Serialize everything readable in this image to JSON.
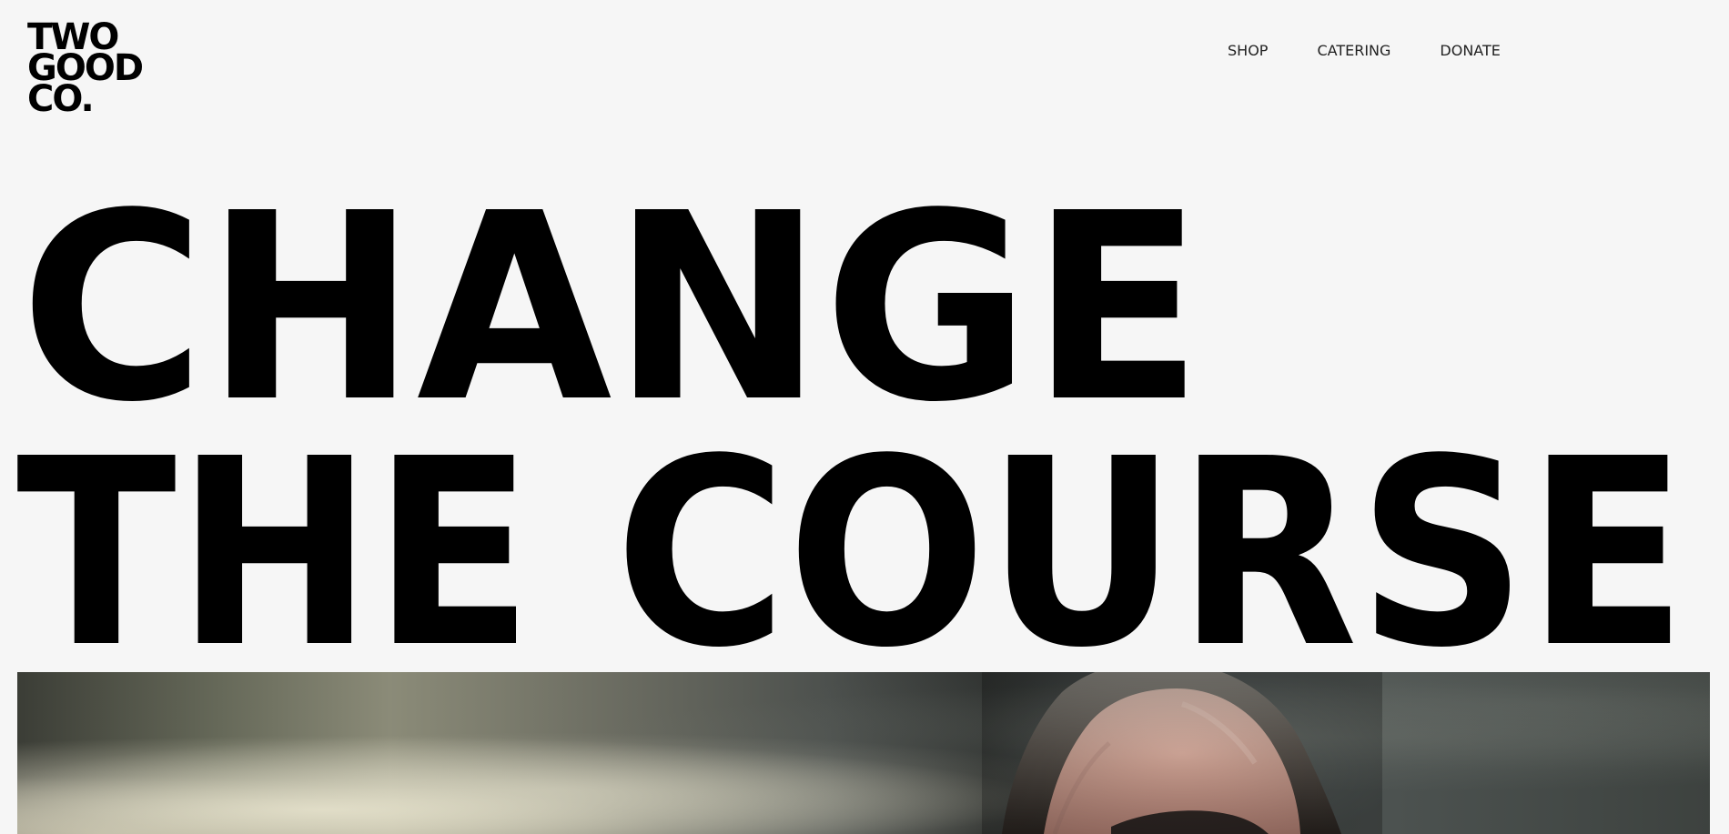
{
  "brand": {
    "logo_lines": [
      "TWO",
      "GOOD",
      "CO."
    ]
  },
  "nav": {
    "items": [
      {
        "label": "SHOP"
      },
      {
        "label": "CATERING"
      },
      {
        "label": "DONATE"
      }
    ]
  },
  "hero": {
    "title_line_1": "CHANGE",
    "title_line_2": "THE COURSE"
  },
  "colors": {
    "background": "#f6f6f6",
    "text": "#000000"
  }
}
